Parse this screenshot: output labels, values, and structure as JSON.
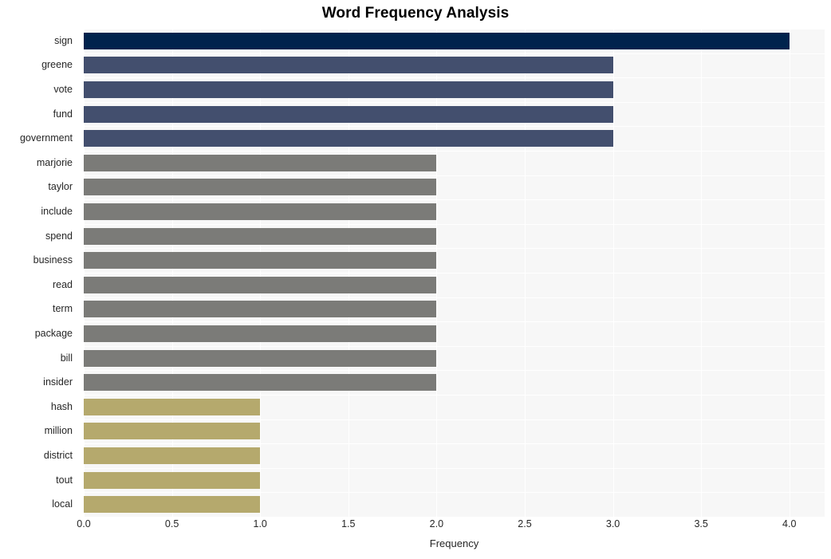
{
  "chart_data": {
    "type": "bar",
    "orientation": "horizontal",
    "title": "Word Frequency Analysis",
    "xlabel": "Frequency",
    "ylabel": "",
    "xlim": [
      0.0,
      4.2
    ],
    "xticks": [
      "0.0",
      "0.5",
      "1.0",
      "1.5",
      "2.0",
      "2.5",
      "3.0",
      "3.5",
      "4.0"
    ],
    "xtick_values": [
      0.0,
      0.5,
      1.0,
      1.5,
      2.0,
      2.5,
      3.0,
      3.5,
      4.0
    ],
    "grid": true,
    "legend": null,
    "categories": [
      "sign",
      "greene",
      "vote",
      "fund",
      "government",
      "marjorie",
      "taylor",
      "include",
      "spend",
      "business",
      "read",
      "term",
      "package",
      "bill",
      "insider",
      "hash",
      "million",
      "district",
      "tout",
      "local"
    ],
    "values": [
      4,
      3,
      3,
      3,
      3,
      2,
      2,
      2,
      2,
      2,
      2,
      2,
      2,
      2,
      2,
      1,
      1,
      1,
      1,
      1
    ],
    "bar_colors": [
      "#00234d",
      "#434f6e",
      "#434f6e",
      "#434f6e",
      "#434f6e",
      "#7b7b78",
      "#7b7b78",
      "#7b7b78",
      "#7b7b78",
      "#7b7b78",
      "#7b7b78",
      "#7b7b78",
      "#7b7b78",
      "#7b7b78",
      "#7b7b78",
      "#b5a96d",
      "#b5a96d",
      "#b5a96d",
      "#b5a96d",
      "#b5a96d"
    ],
    "palette": {
      "rank1": "#00234d",
      "rank2": "#434f6e",
      "rank3": "#7b7b78",
      "rank4": "#b5a96d",
      "plot_background": "#f7f7f7",
      "grid_color": "#ffffff",
      "text_color": "#262626",
      "figure_background": "#ffffff"
    }
  }
}
